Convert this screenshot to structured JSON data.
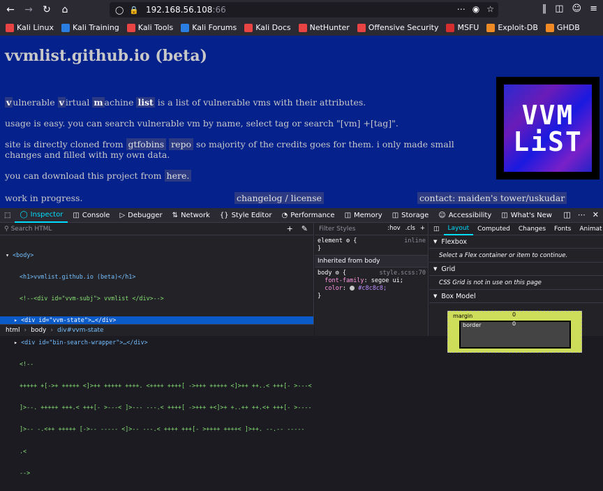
{
  "browser": {
    "url_host": "192.168.56.108",
    "url_port": ":66",
    "bookmarks": [
      {
        "label": "Kali Linux",
        "color": "#e94343"
      },
      {
        "label": "Kali Training",
        "color": "#2a7de1"
      },
      {
        "label": "Kali Tools",
        "color": "#e94343"
      },
      {
        "label": "Kali Forums",
        "color": "#2a7de1"
      },
      {
        "label": "Kali Docs",
        "color": "#e94343"
      },
      {
        "label": "NetHunter",
        "color": "#e94343"
      },
      {
        "label": "Offensive Security",
        "color": "#e94343"
      },
      {
        "label": "MSFU",
        "color": "#d62e2e"
      },
      {
        "label": "Exploit-DB",
        "color": "#f08a24"
      },
      {
        "label": "GHDB",
        "color": "#f08a24"
      }
    ]
  },
  "page": {
    "title": "vvmlist.github.io (beta)",
    "intro": {
      "w1": "v",
      "r1": "ulnerable ",
      "w2": "v",
      "r2": "irtual ",
      "w3": "m",
      "r3": "achine ",
      "w4": "list",
      "r4": " is a list of vulnerable vms with their attributes."
    },
    "usage": "usage is easy. you can search vulnerable vm by name, select tag or search \"[vm] +[tag]\".",
    "credits_pre": "site is directly cloned from ",
    "credits_tag1": "gtfobins",
    "credits_tag2": "repo",
    "credits_post": " so majority of the credits goes for them. i only made small changes and filled with my own data.",
    "download_pre": "you can download this project from ",
    "download_link": "here.",
    "wip": "work in progress.",
    "changelog": "changelog / license",
    "contact": "contact: maiden's tower/uskudar",
    "logo_line1": "VVM",
    "logo_line2": "LiST"
  },
  "devtools": {
    "tabs": [
      "Inspector",
      "Console",
      "Debugger",
      "Network",
      "Style Editor",
      "Performance",
      "Memory",
      "Storage",
      "Accessibility",
      "What's New"
    ],
    "search_placeholder": "Search HTML",
    "html_lines": [
      "<body>",
      "<h1>vvmlist.github.io (beta)</h1>",
      "<!--<div id=\"vvm-subj\"> vvmlist </div>-->",
      "<div id=\"vvm-state\">…</div>",
      "<div id=\"bin-search-wrapper\">…</div>",
      "<!--",
      "+++++ +[->+ +++++ <]>++ +++++ ++++. <++++ ++++[ ->+++ +++++ <]>++ ++..< +++[- >---<",
      "]>--. +++++ +++.< +++[- >---< ]>--- ---.< ++++[ ->+++ +<]>+ +..++ ++.<+ +++[- >----",
      "]>-- -.<++ +++++ [->-- ----- <]>-- ---.< ++++ +++[- >++++ ++++< ]>++. --.-- -----",
      ".<",
      "-->"
    ],
    "breadcrumb": [
      "html",
      "body",
      "div#vvm-state"
    ],
    "filter_placeholder": "Filter Styles",
    "filter_hov": ":hov",
    "filter_cls": ".cls",
    "element_rule": "element",
    "element_src": "inline",
    "inherited_label": "Inherited from body",
    "body_selector": "body",
    "body_src": "style.scss:70",
    "font_prop": "font-family",
    "font_val": "segoe ui;",
    "color_prop": "color",
    "color_val": "#c8c8c8;",
    "right_tabs": [
      "Layout",
      "Computed",
      "Changes",
      "Fonts",
      "Animat"
    ],
    "flexbox_title": "Flexbox",
    "flexbox_msg": "Select a Flex container or item to continue.",
    "grid_title": "Grid",
    "grid_msg": "CSS Grid is not in use on this page",
    "boxmodel_title": "Box Model",
    "margin_label": "margin",
    "border_label": "border",
    "margin_val": "0",
    "border_val": "0"
  },
  "colors": {
    "page_bg": "#05218c",
    "page_text": "#c8c8c8",
    "devtools_accent": "#00ddff",
    "selection": "#0a5ac8"
  }
}
